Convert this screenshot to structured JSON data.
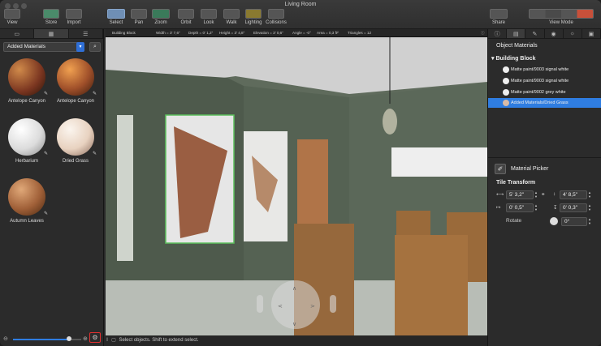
{
  "window": {
    "title": "Living Room"
  },
  "toolbar": {
    "view": "View",
    "store": "Store",
    "import": "Import",
    "select": "Select",
    "pan": "Pan",
    "zoom": "Zoom",
    "orbit": "Orbit",
    "look": "Look",
    "walk": "Walk",
    "lighting": "Lighting",
    "collisions": "Collisions",
    "share": "Share",
    "view_mode": "View Mode"
  },
  "infobar": {
    "object": "Building Block",
    "width": "Width = 3' 7,6\"",
    "depth": "Depth = 0' 1,2\"",
    "height": "Height = 3' 4,8\"",
    "elevation": "Elevation = 3' 0,6\"",
    "angle": "Angle = -0°",
    "area": "Area = 0,3 ft²",
    "triangles": "Triangles = 12"
  },
  "left_panel": {
    "dropdown": "Added Materials",
    "materials": [
      {
        "name": "Antelope Canyon"
      },
      {
        "name": "Antelope Canyon"
      },
      {
        "name": "Herbarium"
      },
      {
        "name": "Dried Grass"
      },
      {
        "name": "Autumn Leaves"
      }
    ]
  },
  "status": {
    "text": "Select objects. Shift to extend select."
  },
  "right_panel": {
    "header": "Object Materials",
    "group": "Building Block",
    "items": [
      {
        "label": "Matte paint/9003 signal white"
      },
      {
        "label": "Matte paint/9003 signal white"
      },
      {
        "label": "Matte paint/9002 grey white"
      },
      {
        "label": "Added Materials/Dried Grass"
      }
    ],
    "picker": "Material Picker",
    "tile_transform": "Tile Transform",
    "w": "5' 3,2\"",
    "h": "4' 8,5\"",
    "ox": "0' 0,5\"",
    "oy": "0' 0,3\"",
    "rotate_label": "Rotate",
    "rotate": "0°"
  }
}
